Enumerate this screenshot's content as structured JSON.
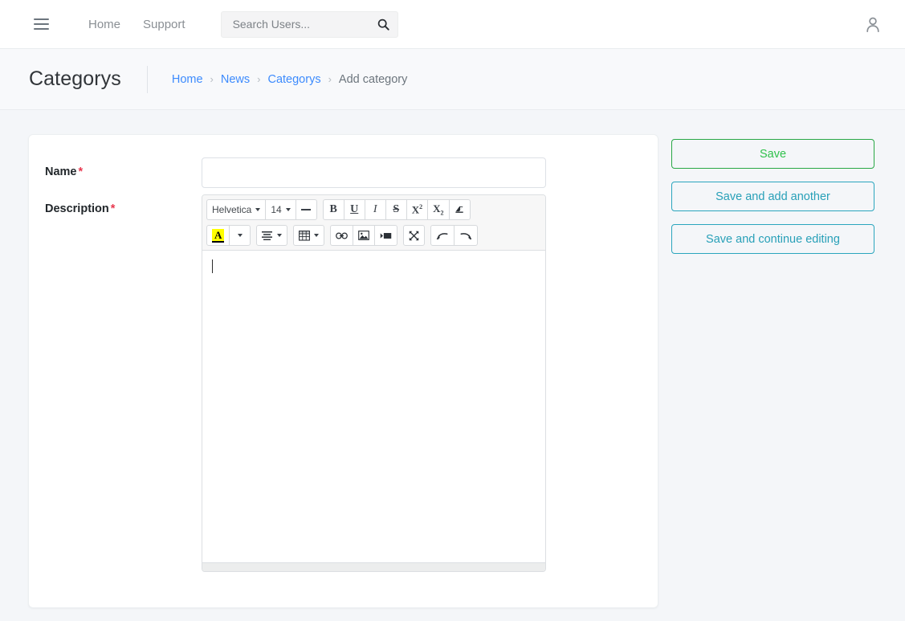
{
  "navbar": {
    "menu_icon": "hamburger-icon",
    "links": [
      {
        "label": "Home"
      },
      {
        "label": "Support"
      }
    ],
    "search": {
      "placeholder": "Search Users...",
      "value": "",
      "icon": "search-icon"
    },
    "account_icon": "user-icon"
  },
  "page_header": {
    "title": "Categorys",
    "breadcrumb": [
      {
        "label": "Home",
        "link": true
      },
      {
        "label": "News",
        "link": true
      },
      {
        "label": "Categorys",
        "link": true
      },
      {
        "label": "Add category",
        "link": false
      }
    ],
    "separator": "›"
  },
  "form": {
    "fields": [
      {
        "label": "Name",
        "required_mark": "*",
        "value": "",
        "placeholder": ""
      },
      {
        "label": "Description",
        "required_mark": "*",
        "value": "",
        "placeholder": ""
      }
    ]
  },
  "editor": {
    "toolbar_row1": [
      {
        "name": "font-family-dropdown",
        "label": "Helvetica",
        "caret": true
      },
      {
        "name": "font-size-dropdown",
        "label": "14",
        "caret": true
      },
      {
        "name": "remove-format-button",
        "label": "—"
      },
      {
        "name": "bold-button",
        "label": "B"
      },
      {
        "name": "underline-button",
        "label": "U"
      },
      {
        "name": "italic-button",
        "label": "I"
      },
      {
        "name": "strikethrough-button",
        "label": "S"
      },
      {
        "name": "superscript-button",
        "label": "X"
      },
      {
        "name": "subscript-button",
        "label": "X"
      },
      {
        "name": "clear-formatting-button",
        "label": "◰"
      }
    ],
    "toolbar_row2": [
      {
        "name": "text-color-button",
        "label": "A"
      },
      {
        "name": "text-color-dropdown",
        "label": ""
      },
      {
        "name": "paragraph-align-button",
        "label": ""
      },
      {
        "name": "table-button",
        "label": ""
      },
      {
        "name": "link-button",
        "label": ""
      },
      {
        "name": "picture-button",
        "label": ""
      },
      {
        "name": "video-button",
        "label": ""
      },
      {
        "name": "fullscreen-button",
        "label": ""
      },
      {
        "name": "undo-button",
        "label": ""
      },
      {
        "name": "redo-button",
        "label": ""
      }
    ],
    "content": "",
    "cursor_visible": true
  },
  "side_actions": [
    {
      "label": "Save",
      "style": "green"
    },
    {
      "label": "Save and add another",
      "style": "teal"
    },
    {
      "label": "Save and continue editing",
      "style": "teal"
    }
  ],
  "colors": {
    "page_background": "#f4f6f9",
    "card_background": "#ffffff",
    "link": "#3d8bfd",
    "required": "#e8384f",
    "save_green": "#2fc14b",
    "save_teal": "#28a0b8",
    "toolbar_background": "#f7f7f7",
    "highlight_yellow": "#ffff00"
  }
}
